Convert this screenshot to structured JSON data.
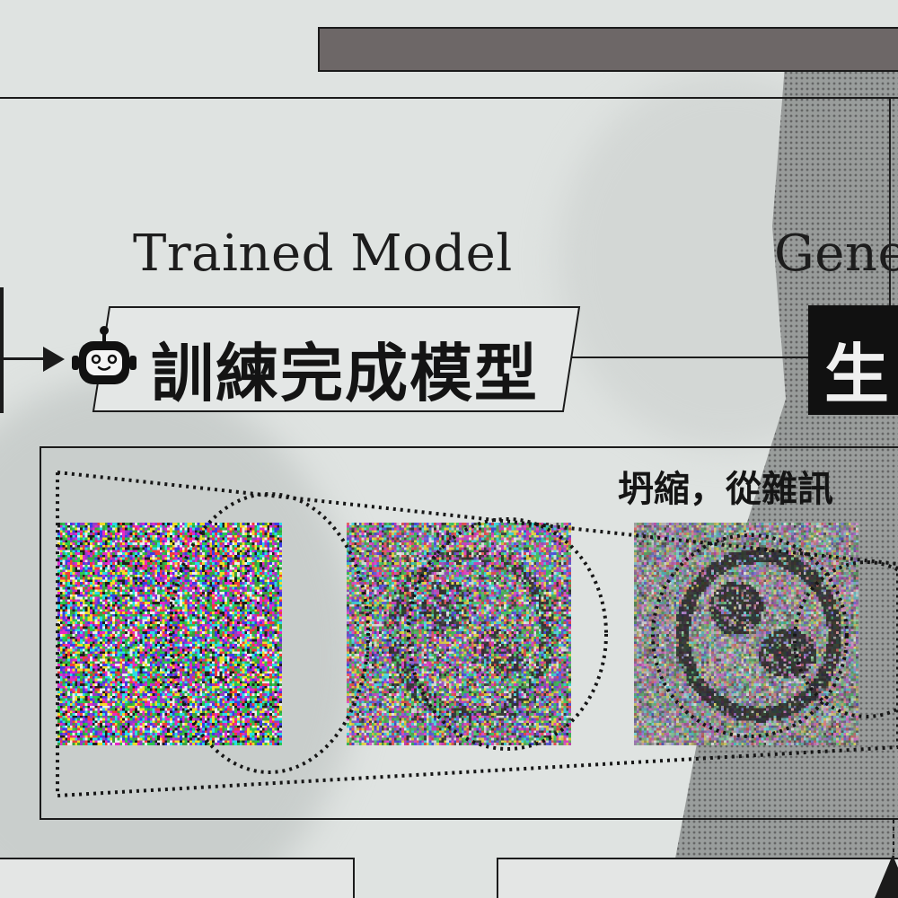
{
  "labels": {
    "trained_model_en": "Trained Model",
    "trained_model_zh": "訓練完成模型",
    "generate_en_partial": "Gene",
    "generate_zh_partial": "生",
    "panel_caption_partial": "坍縮，從雜訊"
  },
  "icons": {
    "robot": "robot-icon",
    "arrow": "arrow-right-icon",
    "arrow_up": "arrow-up-icon"
  },
  "colors": {
    "ink": "#1b1b1b",
    "paper": "#dfe3e1",
    "top_bar": "#6d6767",
    "generate_block": "#111111"
  },
  "noise_stages": [
    {
      "stage": "pure-noise",
      "structure_strength": 0.0
    },
    {
      "stage": "partial-noise",
      "structure_strength": 0.35
    },
    {
      "stage": "emerging-image",
      "structure_strength": 0.8
    }
  ]
}
